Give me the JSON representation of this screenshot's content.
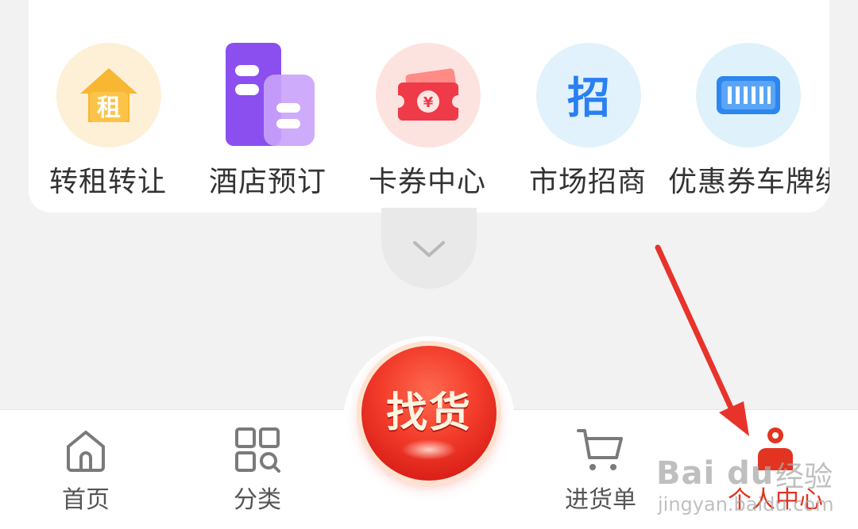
{
  "shortcuts": [
    {
      "label": "转租转让",
      "icon": "house-rent-icon",
      "icon_text": "租"
    },
    {
      "label": "酒店预订",
      "icon": "hotel-building-icon"
    },
    {
      "label": "卡券中心",
      "icon": "coupon-ticket-icon",
      "icon_text": "¥"
    },
    {
      "label": "市场招商",
      "icon": "recruit-icon",
      "icon_text": "招"
    },
    {
      "label": "优惠券车牌绑",
      "icon": "license-plate-icon"
    }
  ],
  "expand": {
    "icon": "chevron-down-icon"
  },
  "tabbar": {
    "items": [
      {
        "label": "首页",
        "icon": "home-icon",
        "active": false
      },
      {
        "label": "分类",
        "icon": "category-grid-icon",
        "active": false
      },
      {
        "label": "进货单",
        "icon": "shopping-cart-icon",
        "active": false
      },
      {
        "label": "个人中心",
        "icon": "user-icon",
        "active": true
      }
    ],
    "center": {
      "label": "找货",
      "icon": "find-goods-button"
    }
  },
  "colors": {
    "accent": "#e23420",
    "background": "#f2f2f2",
    "card": "#ffffff",
    "annotation_arrow": "#e8332a"
  },
  "watermark": {
    "logo": "Bai du",
    "suffix": "经验",
    "url": "jingyan.baidu.com"
  }
}
